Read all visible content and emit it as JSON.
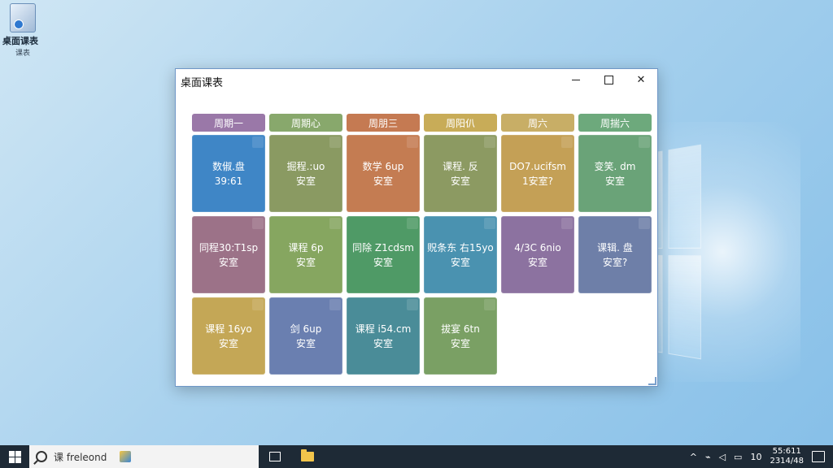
{
  "desktop": {
    "icon_label": "桌面课表",
    "icon_sublabel": "课表"
  },
  "window": {
    "title": "桌面课表",
    "controls": {
      "minimize": "minimize-icon",
      "maximize": "maximize-icon",
      "close": "✕"
    }
  },
  "schedule": {
    "headers": [
      "周期一",
      "周期心",
      "周朋三",
      "周阳仈",
      "周六",
      "周揣六"
    ],
    "header_colors": [
      "#9a78a8",
      "#88a86c",
      "#c57a52",
      "#c8ac58",
      "#c8ae66",
      "#6da97c"
    ],
    "cells": [
      {
        "line1": "数俶.盘",
        "line2": "39:61",
        "color": "#3f86c6"
      },
      {
        "line1": "掘程.:uo",
        "line2": "安室",
        "color": "#8a9a62"
      },
      {
        "line1": "数学 6up",
        "line2": "安室",
        "color": "#c47c52"
      },
      {
        "line1": "课程. 反",
        "line2": "安室",
        "color": "#8c9a62"
      },
      {
        "line1": "DO7.ucifsm",
        "line2": "1安室?",
        "color": "#c4a056"
      },
      {
        "line1": "变笑. dm",
        "line2": "安室",
        "color": "#6aa378"
      },
      {
        "line1": "同程30:T1sp",
        "line2": "安室",
        "color": "#9c7288"
      },
      {
        "line1": "课程 6p",
        "line2": "安室",
        "color": "#86a660"
      },
      {
        "line1": "同除 Z1cdsm",
        "line2": "安室",
        "color": "#4f9a66"
      },
      {
        "line1": "贶条东 右15yo",
        "line2": "安室",
        "color": "#4a92b0"
      },
      {
        "line1": "4/3C 6nio",
        "line2": "安室",
        "color": "#8c72a0"
      },
      {
        "line1": "课辑. 盘",
        "line2": "安室?",
        "color": "#6e7fa8"
      },
      {
        "line1": "课程 16yo",
        "line2": "安室",
        "color": "#c4a756"
      },
      {
        "line1": "剑 6up",
        "line2": "安室",
        "color": "#6a7fb0"
      },
      {
        "line1": "课程 i54.cm",
        "line2": "安室",
        "color": "#4a8c98"
      },
      {
        "line1": "拔宴 6tn",
        "line2": "安室",
        "color": "#7aa064"
      }
    ]
  },
  "taskbar": {
    "search_text": "课 freleond",
    "tray_number": "10",
    "clock_time": "55:611",
    "clock_date": "2314/48"
  }
}
